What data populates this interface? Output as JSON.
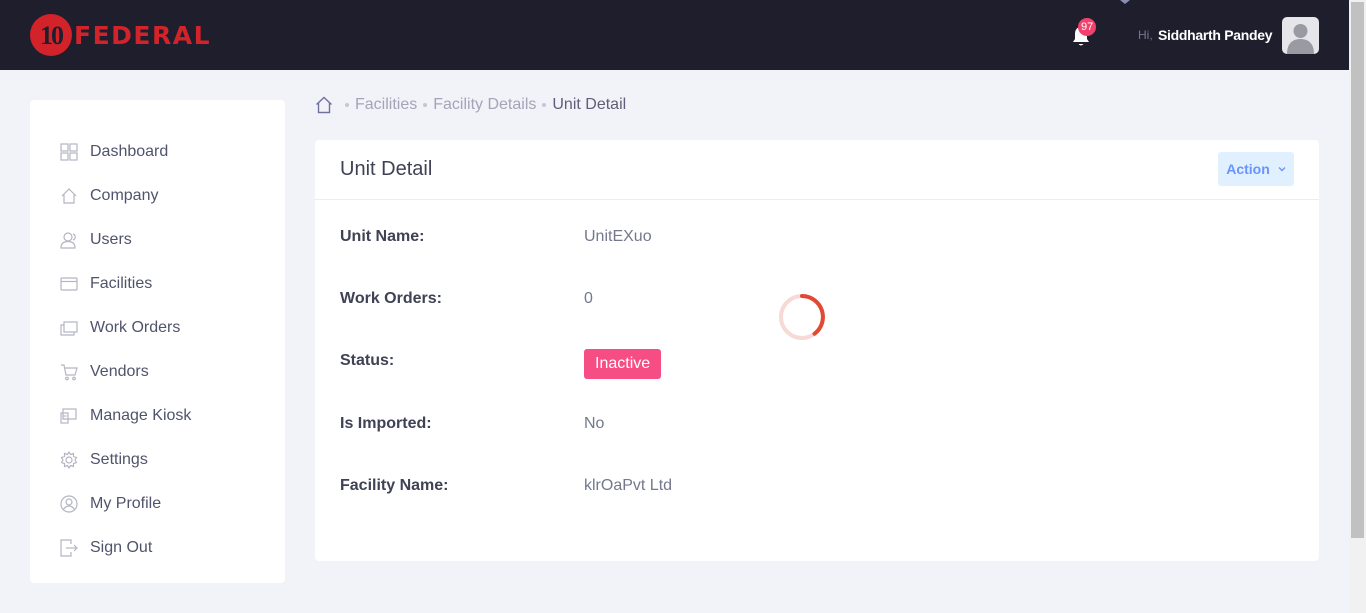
{
  "header": {
    "logo_number": "10",
    "logo_text": "FEDERAL",
    "notification_count": "97",
    "greeting": "Hi,",
    "user_name": "Siddharth Pandey"
  },
  "sidebar": {
    "items": [
      {
        "label": "Dashboard",
        "icon": "dashboard-icon"
      },
      {
        "label": "Company",
        "icon": "home-icon"
      },
      {
        "label": "Users",
        "icon": "users-icon"
      },
      {
        "label": "Facilities",
        "icon": "facilities-icon"
      },
      {
        "label": "Work Orders",
        "icon": "work-orders-icon"
      },
      {
        "label": "Vendors",
        "icon": "cart-icon"
      },
      {
        "label": "Manage Kiosk",
        "icon": "kiosk-icon"
      },
      {
        "label": "Settings",
        "icon": "gear-icon"
      },
      {
        "label": "My Profile",
        "icon": "profile-icon"
      },
      {
        "label": "Sign Out",
        "icon": "sign-out-icon"
      }
    ]
  },
  "breadcrumb": {
    "items": [
      "Facilities",
      "Facility Details",
      "Unit Detail"
    ]
  },
  "card": {
    "title": "Unit Detail",
    "action_label": "Action",
    "rows": [
      {
        "label": "Unit Name:",
        "value": "UnitEXuo"
      },
      {
        "label": "Work Orders:",
        "value": "0"
      },
      {
        "label": "Status:",
        "value": "Inactive"
      },
      {
        "label": "Is Imported:",
        "value": "No"
      },
      {
        "label": "Facility Name:",
        "value": "klrOaPvt Ltd"
      }
    ]
  },
  "colors": {
    "header_bg": "#1e1e2d",
    "brand_red": "#d2232a",
    "badge_pink": "#f1416c",
    "status_inactive": "#f64e84",
    "action_bg": "#e1f0ff",
    "action_text": "#6993ff"
  }
}
